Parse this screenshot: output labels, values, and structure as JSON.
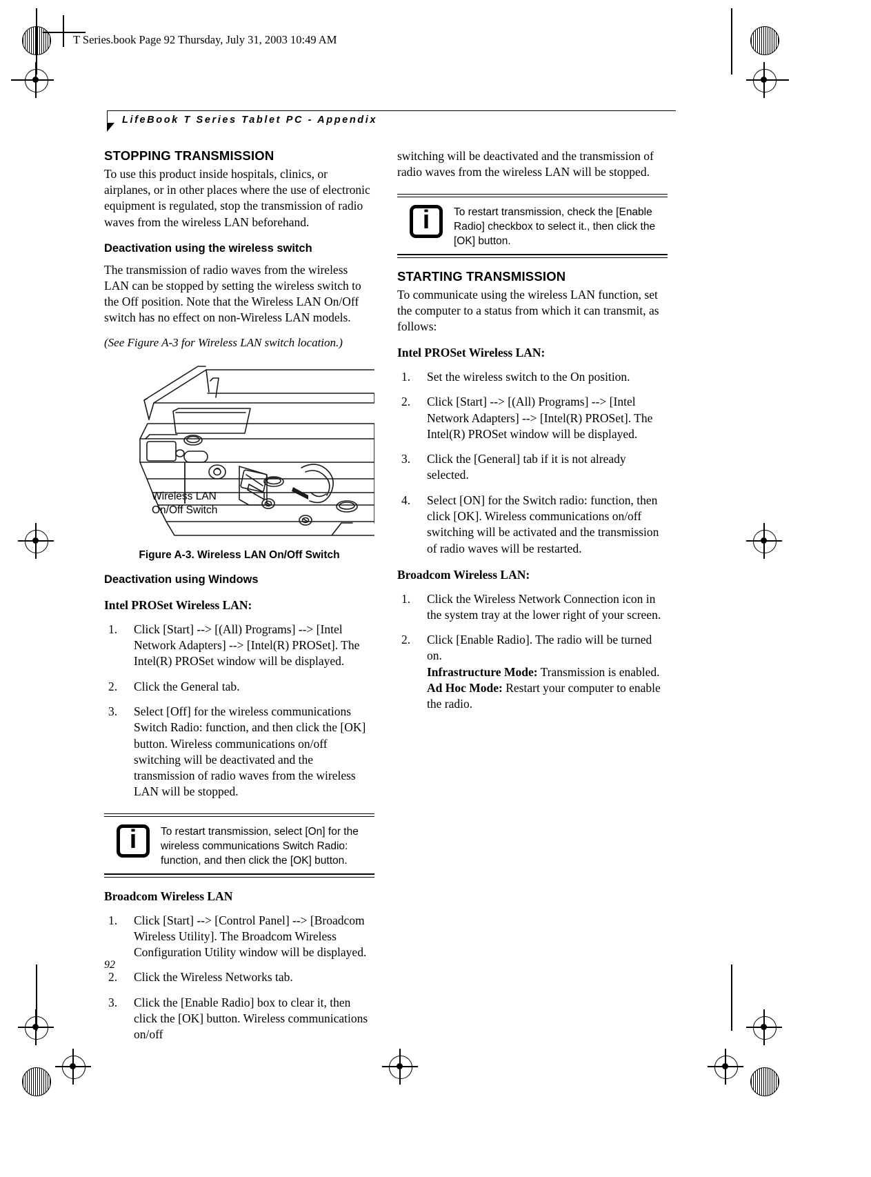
{
  "page": {
    "file_stamp": "T Series.book  Page 92  Thursday, July 31, 2003  10:49 AM",
    "running_head": "LifeBook T Series Tablet PC - Appendix",
    "folio": "92"
  },
  "left_column": {
    "heading": "STOPPING TRANSMISSION",
    "intro": "To use this product inside hospitals, clinics, or airplanes, or in other places where the use of electronic equipment is regulated, stop the transmission of radio waves from the wireless LAN beforehand.",
    "sub1": "Deactivation using the wireless switch",
    "para1": "The transmission of radio waves from the wireless LAN can be stopped by setting the wireless switch to the Off position. Note that the Wireless LAN On/Off switch has no effect on non-Wireless LAN models.",
    "figure_ref": "(See Figure A-3 for Wireless LAN switch location.)",
    "figure": {
      "callout_line1": "Wireless LAN",
      "callout_line2": "On/Off Switch",
      "caption": "Figure A-3. Wireless LAN On/Off Switch"
    },
    "sub2": "Deactivation using Windows",
    "lead_intel": "Intel PROSet Wireless LAN:",
    "intel_steps": [
      "Click [Start] --> [(All) Programs] --> [Intel Network Adapters] --> [Intel(R) PROSet]. The Intel(R) PROSet window will be displayed.",
      "Click the General tab.",
      "Select [Off] for the wireless communications Switch Radio: function, and then click the [OK] button. Wireless communications on/off switching will be deactivated and the transmission of radio waves from the wireless LAN will be stopped."
    ],
    "note": {
      "icon": "info-icon",
      "text": "To restart transmission, select [On] for the wireless communications Switch Radio: function, and then click the [OK] button."
    },
    "lead_broadcom": "Broadcom Wireless LAN",
    "broadcom_steps": [
      "Click [Start] --> [Control Panel] --> [Broadcom Wireless Utility]. The Broadcom Wireless Configuration Utility window will be displayed.",
      "Click the Wireless Networks tab.",
      "Click the [Enable Radio] box to clear it, then click the [OK] button. Wireless communications on/off"
    ]
  },
  "right_column": {
    "continued": "switching will be deactivated and the transmission of radio waves from the wireless LAN will be stopped.",
    "note": {
      "icon": "info-icon",
      "text": "To restart transmission, check the [Enable Radio] checkbox to select it., then click the [OK] button."
    },
    "heading": "STARTING TRANSMISSION",
    "intro": "To communicate using the wireless LAN function, set the computer to a status from which it can transmit, as follows:",
    "lead_intel": "Intel PROSet Wireless LAN:",
    "intel_steps": [
      "Set the wireless switch to the On position.",
      "Click [Start] --> [(All) Programs] --> [Intel Network Adapters] --> [Intel(R) PROSet]. The Intel(R) PROSet window will be displayed.",
      "Click the [General] tab if it is not already selected.",
      "Select [ON] for the Switch radio: function, then click [OK]. Wireless communications on/off switching will be activated and the transmission of radio waves will be restarted."
    ],
    "lead_broadcom": "Broadcom Wireless LAN:",
    "broadcom_steps": [
      {
        "text": "Click the Wireless Network Connection icon in the system tray at the lower right of your screen.",
        "bold_runs": []
      },
      {
        "text": "Click [Enable Radio]. The radio will be turned on.",
        "bold_runs": [
          {
            "label": "Infrastructure Mode:",
            "rest": " Transmission is enabled."
          },
          {
            "label": "Ad Hoc Mode:",
            "rest": " Restart your computer to enable the radio."
          }
        ]
      }
    ]
  }
}
